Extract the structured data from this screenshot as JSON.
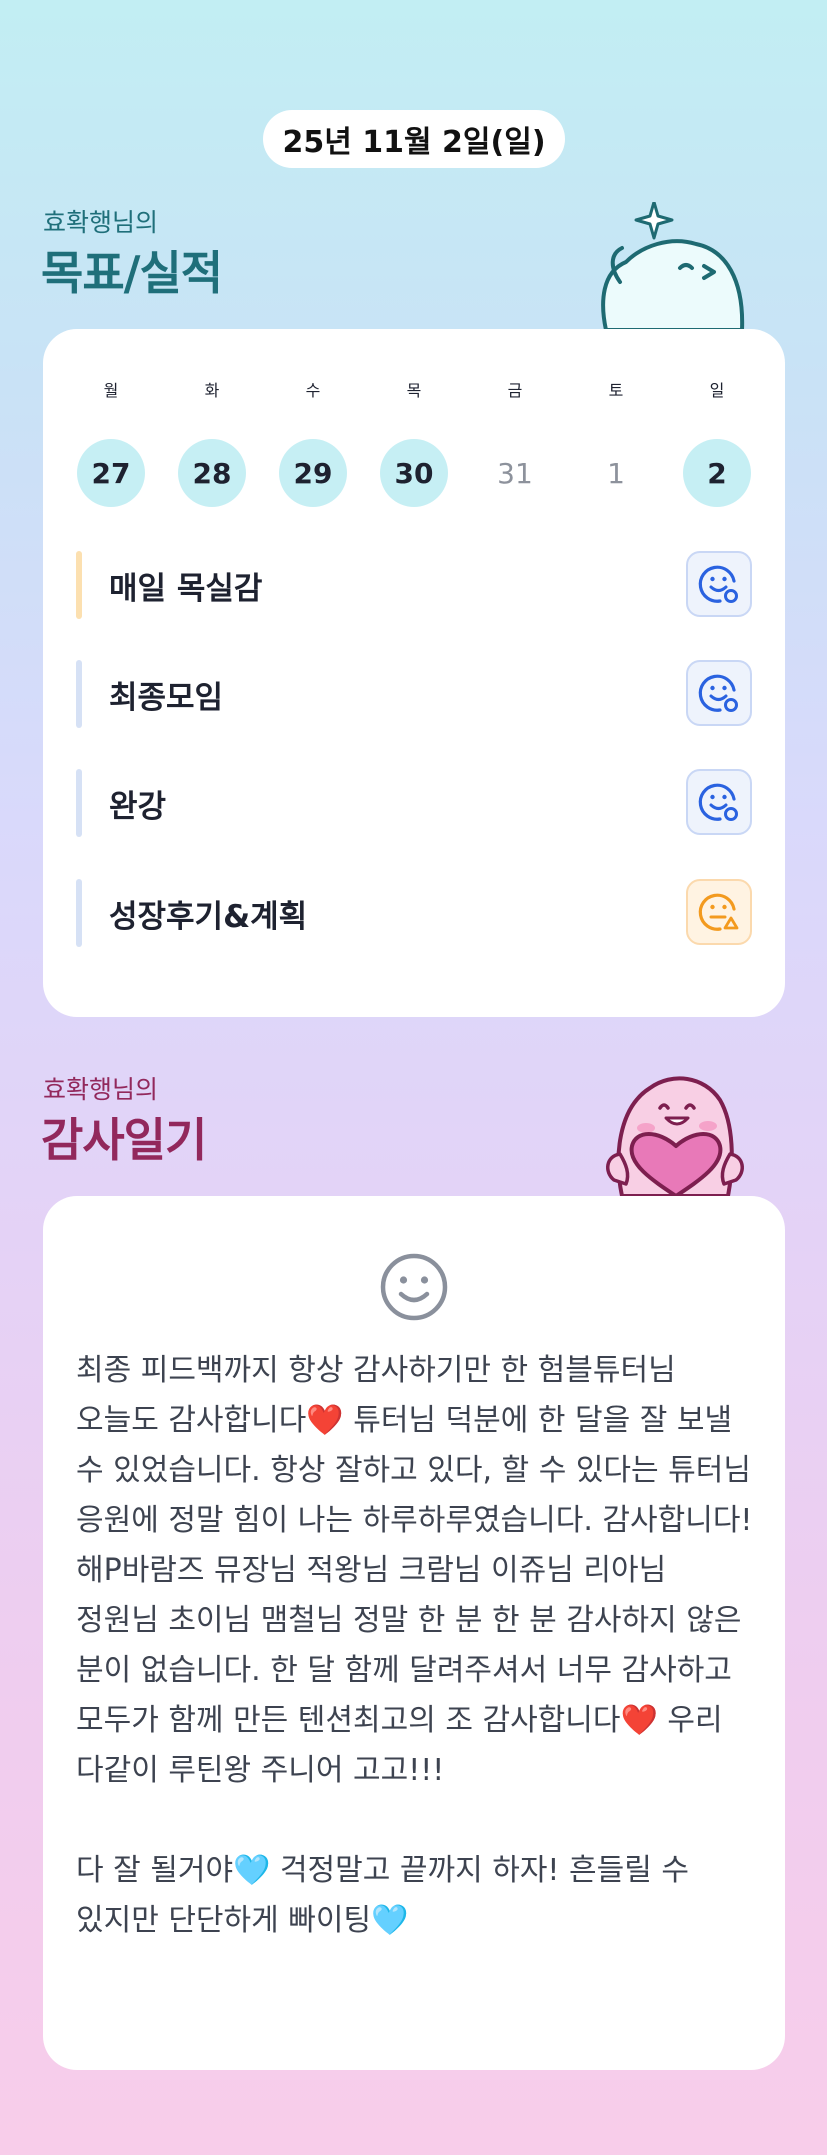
{
  "header": {
    "date": "25년 11월 2일(일)"
  },
  "goals_section": {
    "subtitle": "효확행님의",
    "title": "목표/실적",
    "weekdays": [
      "월",
      "화",
      "수",
      "목",
      "금",
      "토",
      "일"
    ],
    "dates": [
      {
        "num": "27",
        "done": true
      },
      {
        "num": "28",
        "done": true
      },
      {
        "num": "29",
        "done": true
      },
      {
        "num": "30",
        "done": true
      },
      {
        "num": "31",
        "done": false
      },
      {
        "num": "1",
        "done": false
      },
      {
        "num": "2",
        "done": true
      }
    ],
    "goals": [
      {
        "label": "매일 목실감",
        "bar_color": "#fce0b0",
        "icon": "smile-face-icon",
        "icon_color": "#2a62e0"
      },
      {
        "label": "최종모임",
        "bar_color": "#d6e1f5",
        "icon": "smile-face-icon",
        "icon_color": "#2a62e0"
      },
      {
        "label": "완강",
        "bar_color": "#d6e1f5",
        "icon": "smile-face-icon",
        "icon_color": "#2a62e0"
      },
      {
        "label": "성장후기&계획",
        "bar_color": "#d6e1f5",
        "icon": "meh-face-icon",
        "icon_color": "#f39a1e"
      }
    ]
  },
  "gratitude_section": {
    "subtitle": "효확행님의",
    "title": "감사일기",
    "mood_icon": "smile-face-icon",
    "text": "최종 피드백까지 항상 감사하기만 한 험블튜터님 오늘도 감사합니다❤️ 튜터님 덕분에 한 달을 잘 보낼 수 있었습니다. 항상 잘하고 있다, 할 수 있다는 튜터님 응원에 정말 힘이 나는 하루하루였습니다. 감사합니다!\n해P바람즈 뮤장님 적왕님 크람님 이쥬님 리아님 정원님 초이님 맴철님 정말 한 분 한 분 감사하지 않은 분이 없습니다. 한 달 함께 달려주셔서 너무 감사하고 모두가 함께 만든 텐션최고의 조 감사합니다❤️ 우리 다같이 루틴왕 주니어 고고!!!\n\n다 잘 될거야🩵 걱정말고 끝까지 하자! 흔들릴 수 있지만 단단하게 빠이팅🩵"
  },
  "colors": {
    "goals_title": "#1f6f7a",
    "gratitude_title": "#92285c",
    "done_circle": "#c6eff4"
  }
}
